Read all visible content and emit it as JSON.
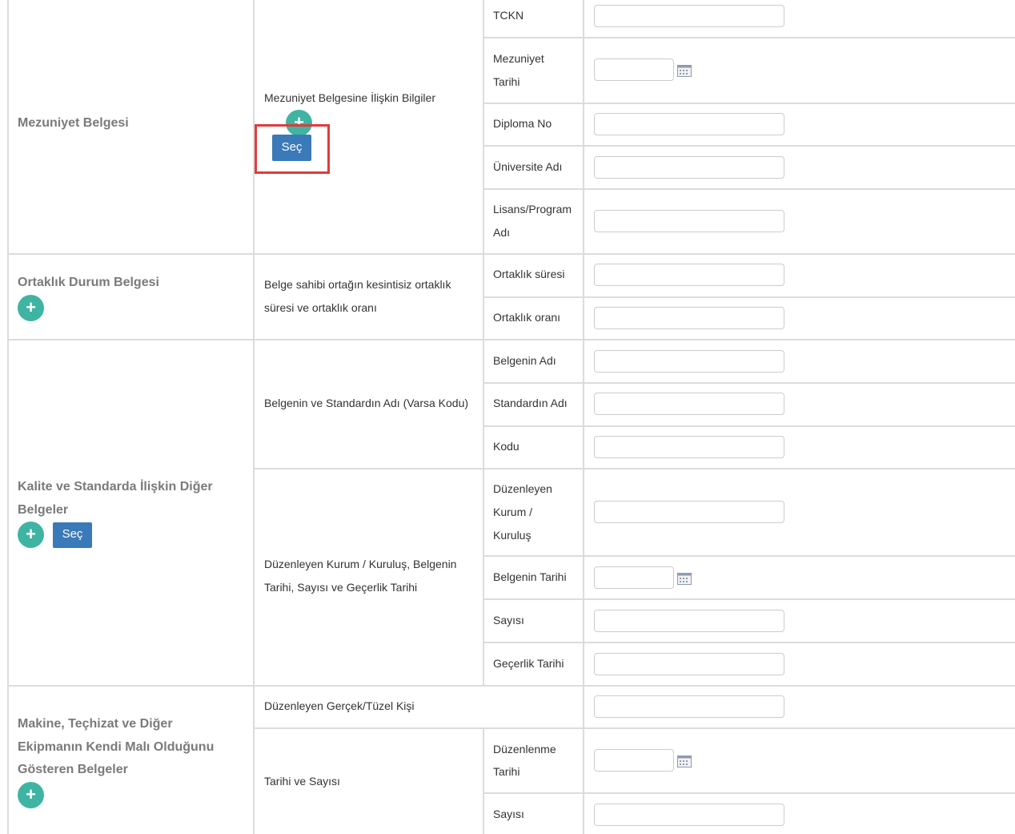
{
  "colors": {
    "accent_teal": "#3fb4a3",
    "button_blue": "#3a7ab8",
    "highlight_red": "#e03b3b",
    "grid": "#dcdcdc"
  },
  "sections": {
    "mezuniyet": {
      "title": "Mezuniyet Belgesi",
      "description": "Mezuniyet Belgesine İlişkin Bilgiler",
      "add_icon": "+",
      "select_label": "Seç",
      "fields": {
        "tckn": "TCKN",
        "mezuniyet_tarihi_1": "Mezuniyet",
        "mezuniyet_tarihi_2": "Tarihi",
        "diploma_no": "Diploma No",
        "universite_adi": "Üniversite Adı",
        "lisans_program_1": "Lisans/Program",
        "lisans_program_2": "Adı"
      }
    },
    "ortaklik": {
      "title": "Ortaklık Durum Belgesi",
      "add_icon": "+",
      "description_1": "Belge sahibi ortağın kesintisiz ortaklık",
      "description_2": "süresi ve ortaklık oranı",
      "fields": {
        "ortaklik_suresi": "Ortaklık süresi",
        "ortaklik_orani": "Ortaklık oranı"
      }
    },
    "kalite": {
      "title_1": "Kalite ve Standarda İlişkin Diğer",
      "title_2": "Belgeler",
      "add_icon": "+",
      "select_label": "Seç",
      "group1_description": "Belgenin ve Standardın Adı (Varsa Kodu)",
      "group2_description_1": "Düzenleyen Kurum / Kuruluş, Belgenin",
      "group2_description_2": "Tarihi, Sayısı ve Geçerlik Tarihi",
      "fields": {
        "belgenin_adi": "Belgenin Adı",
        "standardin_adi": "Standardın Adı",
        "kodu": "Kodu",
        "duzenleyen_1": "Düzenleyen",
        "duzenleyen_2": "Kurum /",
        "duzenleyen_3": "Kuruluş",
        "belgenin_tarihi": "Belgenin Tarihi",
        "sayisi": "Sayısı",
        "gecerlik_tarihi": "Geçerlik Tarihi"
      }
    },
    "makine": {
      "title_1": "Makine, Teçhizat ve Diğer",
      "title_2": "Ekipmanın Kendi Malı Olduğunu",
      "title_3": "Gösteren Belgeler",
      "add_icon": "+",
      "duzenleyen_kisi": "Düzenleyen Gerçek/Tüzel Kişi",
      "tarih_sayisi": "Tarihi ve Sayısı",
      "fields": {
        "duzenlenme_1": "Düzenlenme",
        "duzenlenme_2": "Tarihi",
        "sayisi": "Sayısı"
      }
    }
  },
  "icons": {
    "calendar": "calendar-icon",
    "plus": "plus-icon"
  }
}
